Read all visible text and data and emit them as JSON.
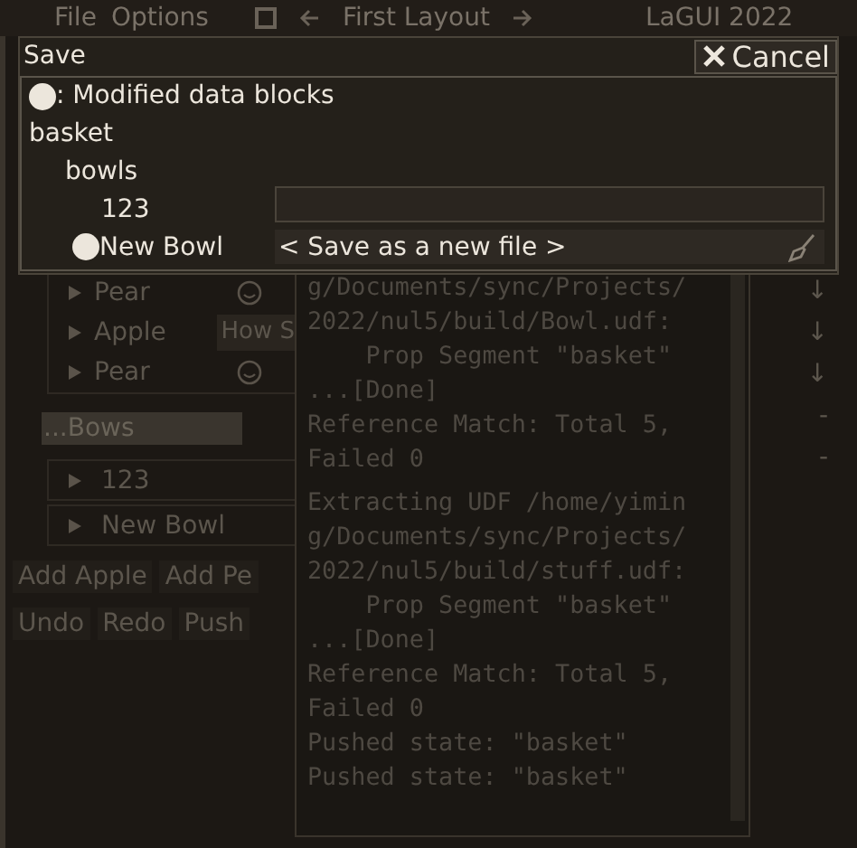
{
  "menubar": {
    "items": [
      "File",
      "Options"
    ],
    "layout": "First Layout",
    "app": "LaGUI 2022"
  },
  "save_dialog": {
    "title": "Save",
    "cancel": "Cancel",
    "legend": ": Modified data blocks",
    "tree": [
      {
        "label": "basket",
        "modified": false,
        "children": [
          {
            "label": "bowls",
            "modified": false,
            "children": [
              {
                "label": "123",
                "modified": false
              },
              {
                "label": "New Bowl",
                "modified": true
              }
            ]
          }
        ]
      }
    ],
    "file_choice": "< Save as a new file >"
  },
  "fruit_list": [
    {
      "label": "Pear"
    },
    {
      "label": "Apple",
      "field": "How S"
    },
    {
      "label": "Pear"
    }
  ],
  "bowl_field": "...Bows",
  "bowl_list": [
    "123",
    "New Bowl"
  ],
  "add_buttons": [
    "Add Apple",
    "Add Pe"
  ],
  "history_buttons": [
    "Undo",
    "Redo",
    "Push"
  ],
  "sort_buttons": [
    "↓",
    "↓",
    "↓"
  ],
  "remove_buttons": [
    "-",
    "-"
  ],
  "console": {
    "lines": [
      "g/Documents/sync/Projects/",
      "2022/nul5/build/Bowl.udf:",
      "    Prop Segment \"basket\"",
      "...[Done]",
      "Reference Match: Total 5,",
      "Failed 0",
      "Extracting UDF /home/yimin",
      "g/Documents/sync/Projects/",
      "2022/nul5/build/stuff.udf:",
      "    Prop Segment \"basket\"",
      "...[Done]",
      "Reference Match: Total 5,",
      "Failed 0",
      "Pushed state: \"basket\"",
      "Pushed state: \"basket\""
    ]
  }
}
